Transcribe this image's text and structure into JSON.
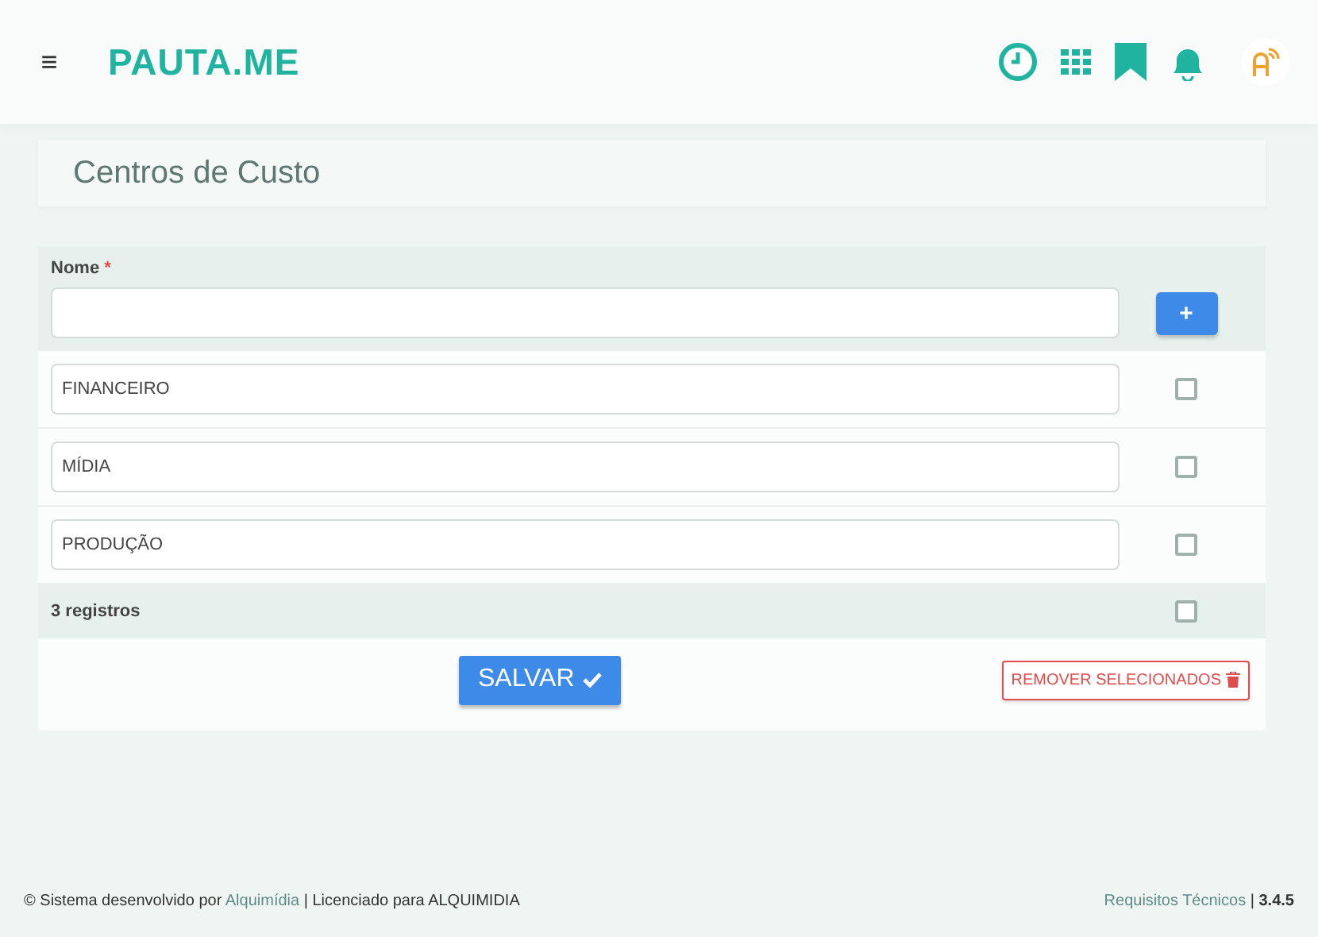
{
  "header": {
    "logo": "PAUTA.ME",
    "menu_glyph": "≡"
  },
  "page": {
    "title": "Centros de Custo"
  },
  "form": {
    "label": "Nome",
    "required_mark": "*",
    "add_button": "+",
    "rows": [
      {
        "value": "FINANCEIRO",
        "checked": false
      },
      {
        "value": "MÍDIA",
        "checked": false
      },
      {
        "value": "PRODUÇÃO",
        "checked": false
      }
    ],
    "count": "3 registros",
    "select_all_checked": false,
    "save_button": "SALVAR",
    "remove_button": "REMOVER SELECIONADOS"
  },
  "footer": {
    "left_before": "© Sistema desenvolvido por ",
    "left_link": "Alquimídia",
    "left_after": " | Licenciado para ALQUIMIDIA",
    "right_link": "Requisitos Técnicos",
    "right_after": " | **3.4.5**"
  }
}
